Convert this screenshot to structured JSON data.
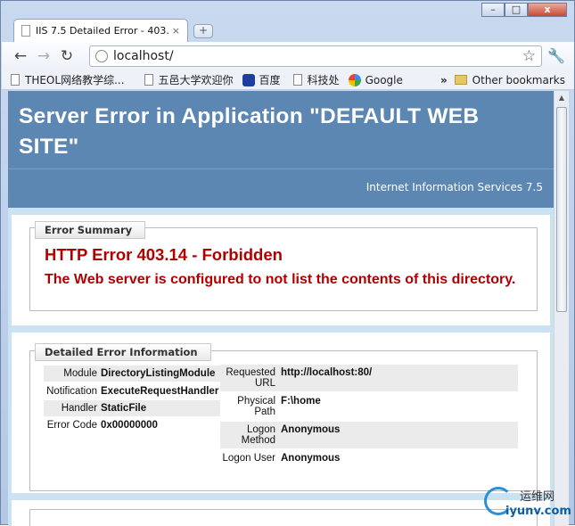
{
  "window": {
    "tab_title": "IIS 7.5 Detailed Error - 403...",
    "tab_close": "×",
    "new_tab": "+",
    "min": "–",
    "max": "□",
    "close": "x"
  },
  "toolbar": {
    "back": "←",
    "forward": "→",
    "reload": "↻",
    "url": "localhost/",
    "star": "☆",
    "wrench": "🔧"
  },
  "bookmarks": {
    "items": [
      "THEOL网络教学综...",
      "五邑大学欢迎你",
      "百度",
      "科技处",
      "Google"
    ],
    "more": "»",
    "other": "Other bookmarks"
  },
  "page": {
    "title": "Server Error in Application \"DEFAULT WEB SITE\"",
    "subtitle": "Internet Information Services 7.5",
    "summary": {
      "legend": "Error Summary",
      "heading": "HTTP Error 403.14 - Forbidden",
      "message": "The Web server is configured to not list the contents of this directory."
    },
    "detail": {
      "legend": "Detailed Error Information",
      "left": [
        {
          "label": "Module",
          "value": "DirectoryListingModule"
        },
        {
          "label": "Notification",
          "value": "ExecuteRequestHandler"
        },
        {
          "label": "Handler",
          "value": "StaticFile"
        },
        {
          "label": "Error Code",
          "value": "0x00000000"
        }
      ],
      "right": [
        {
          "label": "Requested URL",
          "value": "http://localhost:80/"
        },
        {
          "label": "Physical Path",
          "value": "F:\\home"
        },
        {
          "label": "Logon Method",
          "value": "Anonymous"
        },
        {
          "label": "Logon User",
          "value": "Anonymous"
        }
      ]
    }
  },
  "watermark": {
    "cn": "运维网",
    "en": "iyunv.com"
  }
}
